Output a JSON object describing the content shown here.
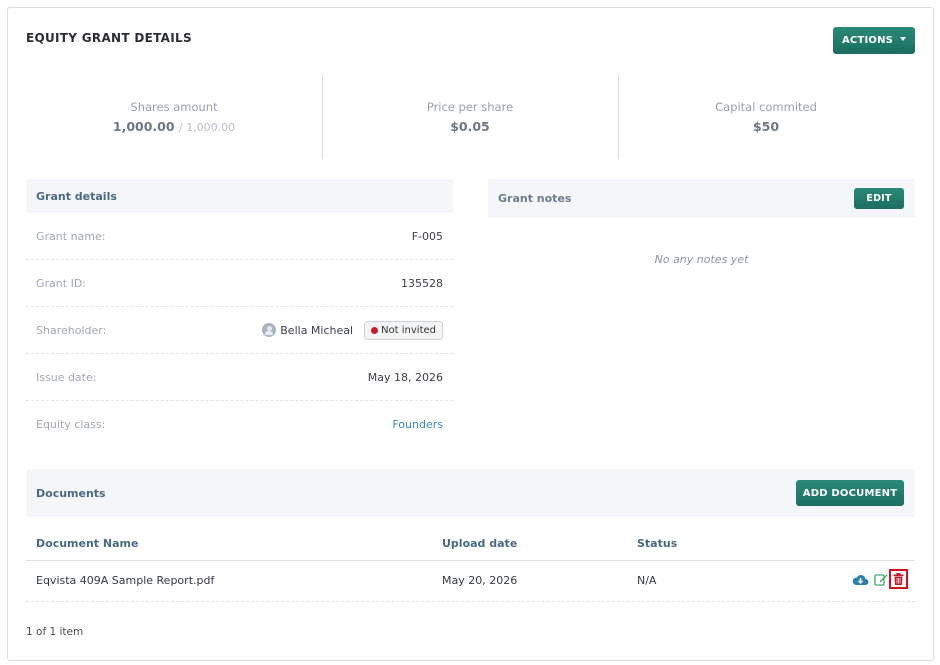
{
  "title": "EQUITY GRANT DETAILS",
  "actions_label": "ACTIONS",
  "stats": {
    "shares_label": "Shares amount",
    "shares_value": "1,000.00",
    "shares_total": "/ 1,000.00",
    "price_label": "Price per share",
    "price_value": "$0.05",
    "capital_label": "Capital commited",
    "capital_value": "$50"
  },
  "grant_details": {
    "heading": "Grant details",
    "rows": [
      {
        "label": "Grant name:",
        "value": "F-005"
      },
      {
        "label": "Grant ID:",
        "value": "135528"
      },
      {
        "label": "Shareholder:",
        "value": "Bella Micheal",
        "badge": "Not invited"
      },
      {
        "label": "Issue date:",
        "value": "May 18, 2026"
      },
      {
        "label": "Equity class:",
        "value": "Founders"
      }
    ]
  },
  "grant_notes": {
    "heading": "Grant notes",
    "edit_label": "EDIT",
    "empty_text": "No any notes yet"
  },
  "documents": {
    "heading": "Documents",
    "add_label": "ADD DOCUMENT",
    "columns": [
      "Document Name",
      "Upload date",
      "Status"
    ],
    "rows": [
      {
        "name": "Eqvista 409A Sample Report.pdf",
        "date": "May 20, 2026",
        "status": "N/A"
      }
    ],
    "row_icons": [
      "cloud-download-icon",
      "edit-icon",
      "trash-icon"
    ]
  },
  "pagination": "1 of 1 item",
  "colors": {
    "accent": "#1f7565",
    "link": "#3a88b3",
    "danger": "#c51b2b",
    "heading": "#4a6a82"
  }
}
